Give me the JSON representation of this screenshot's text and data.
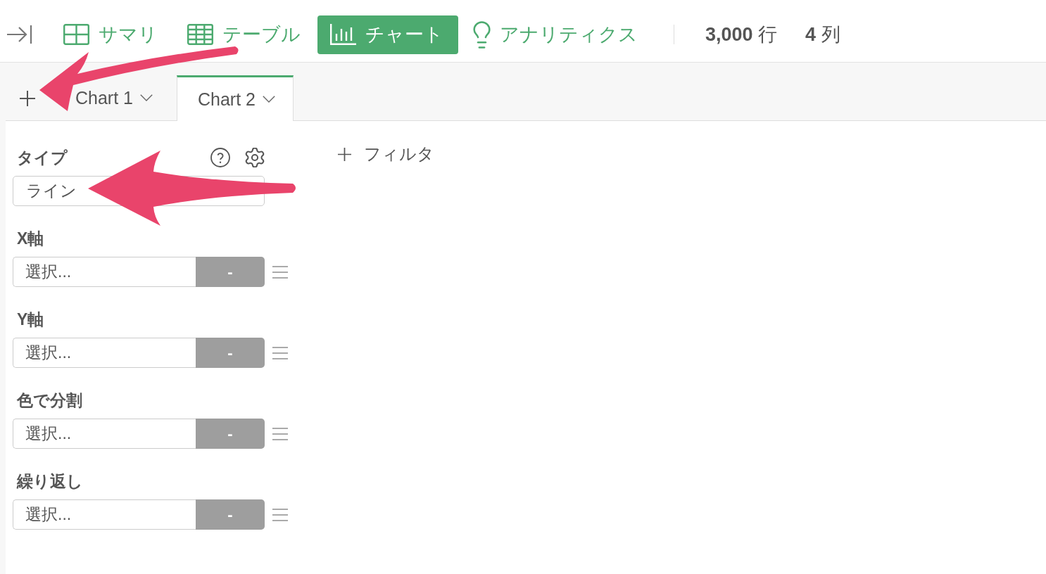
{
  "toolbar": {
    "nav_tabs": [
      {
        "label": "サマリ",
        "selected": false
      },
      {
        "label": "テーブル",
        "selected": false
      },
      {
        "label": "チャート",
        "selected": true
      },
      {
        "label": "アナリティクス",
        "selected": false
      }
    ],
    "row_count": "**3,000** 行",
    "column_count": "**4** 列"
  },
  "chart_tabs": [
    {
      "label": "Chart 1",
      "selected": false
    },
    {
      "label": "Chart 2",
      "selected": true
    }
  ],
  "chart_settings": {
    "type": {
      "label": "タイプ",
      "value": "ライン"
    },
    "fields": [
      {
        "label": "X軸",
        "placeholder": "選択...",
        "button_label": "-"
      },
      {
        "label": "Y軸",
        "placeholder": "選択...",
        "button_label": "-"
      },
      {
        "label": "色で分割",
        "placeholder": "選択...",
        "button_label": "-"
      },
      {
        "label": "繰り返し",
        "placeholder": "選択...",
        "button_label": "-"
      }
    ]
  },
  "filter": {
    "label": "フィルタ"
  },
  "annotations": [
    {
      "kind": "arrow"
    },
    {
      "kind": "arrow"
    }
  ]
}
